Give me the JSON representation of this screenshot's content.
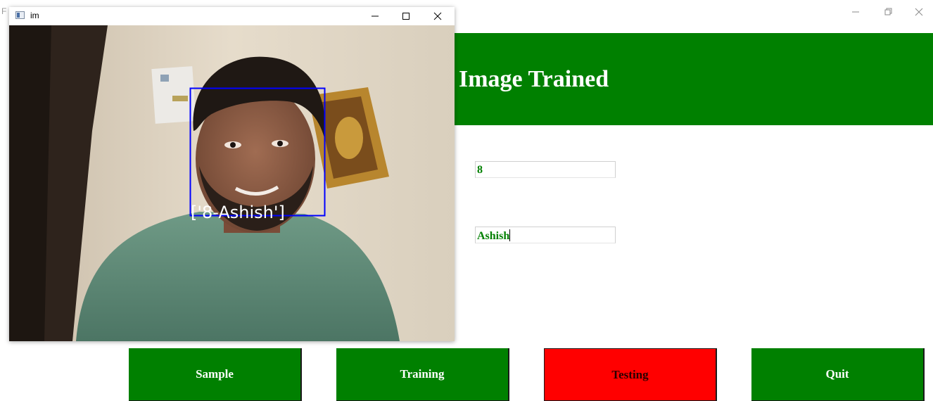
{
  "main_window": {
    "title_fragment": "F",
    "controls": {
      "minimize": "—",
      "maximize": "☐",
      "close": "✕"
    }
  },
  "banner": {
    "text": "Image Trained",
    "color": "#008000"
  },
  "fields": {
    "id_value": "8",
    "name_value": "Ashish"
  },
  "buttons": {
    "sample": "Sample",
    "training": "Training",
    "testing": "Testing",
    "quit": "Quit"
  },
  "colors": {
    "primary_green": "#008000",
    "active_red": "#ff0000",
    "detect_box": "#0000ff"
  },
  "camera_window": {
    "title": "im",
    "detection_label": "['8-Ashish']"
  }
}
